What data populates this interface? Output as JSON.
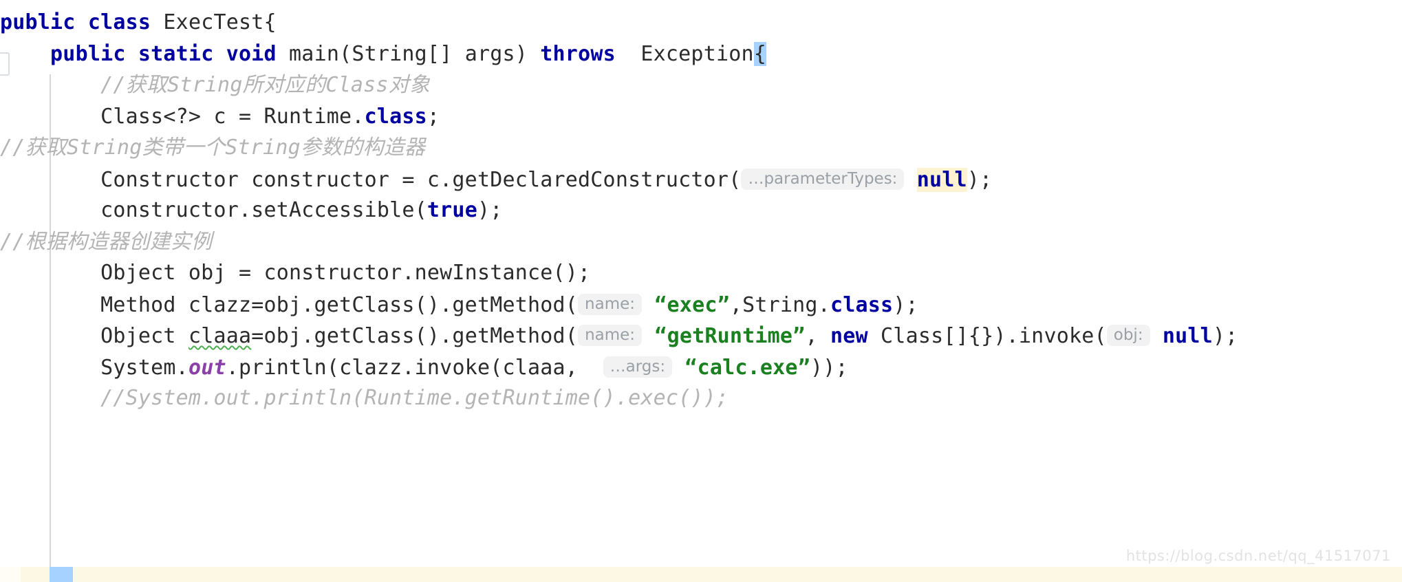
{
  "window": {
    "type": "code-editor",
    "language": "java",
    "file_class": "ExecTest"
  },
  "colors": {
    "background": "#ffffff",
    "keyword": "#0000a0",
    "string": "#1a8020",
    "comment": "#b4b4b4",
    "static_field": "#8b3fa8",
    "plain_text": "#2b2b2b",
    "selection": "#a6d2ff",
    "warning_highlight": "#fdf3d0",
    "inlay_hint_bg": "#f2f2f2",
    "inlay_hint_text": "#9aa0a6",
    "typo_underline": "#4caf50",
    "indent_guide": "#d6d6d6",
    "bottom_strip": "#fdf8e3",
    "watermark": "#e3e3e3"
  },
  "code": {
    "line1": {
      "kw_public": "public",
      "kw_class": "class",
      "name": " ExecTest{"
    },
    "line2": {
      "indent": "    ",
      "kw_public": "public",
      "kw_static": "static",
      "kw_void": "void",
      "signature": " main(String[] args) ",
      "kw_throws": "throws",
      "exception": "  Exception",
      "selected_brace": "{"
    },
    "line3": {
      "comment": "        //获取String所对应的Class对象"
    },
    "line4": {
      "before": "        Class<?> c = Runtime.",
      "kw_class": "class",
      "after": ";"
    },
    "line5": {
      "comment": "//获取String类带一个String参数的构造器"
    },
    "line6": {
      "before": "        Constructor constructor = c.getDeclaredConstructor(",
      "hint": "…parameterTypes:",
      "kw_null": "null",
      "after": ");"
    },
    "line7": {
      "before": "        constructor.setAccessible(",
      "kw_true": "true",
      "after": ");"
    },
    "line8": {
      "comment": "//根据构造器创建实例"
    },
    "line9": {
      "text": "        Object obj = constructor.newInstance();"
    },
    "line10": {
      "before": "        Method clazz=obj.getClass().getMethod(",
      "hint": "name:",
      "string": "“exec”",
      "mid": ",String.",
      "kw_class": "class",
      "after": ");"
    },
    "line11": {
      "before": "        Object ",
      "typo": "claaa",
      "mid1": "=obj.getClass().getMethod(",
      "hint1": "name:",
      "string": "“getRuntime”",
      "mid2": ", ",
      "kw_new": "new",
      "mid3": " Class[]{}).invoke(",
      "hint2": "obj:",
      "kw_null": "null",
      "after": ");"
    },
    "line12": {
      "before": "        System.",
      "static_out": "out",
      "mid": ".println(clazz.invoke(claaa,  ",
      "hint": "…args:",
      "string": "“calc.exe”",
      "after": "));"
    },
    "line13": {
      "comment": "        //System.out.println(Runtime.getRuntime().exec());"
    }
  },
  "watermark": {
    "text": "https://blog.csdn.net/qq_41517071"
  }
}
